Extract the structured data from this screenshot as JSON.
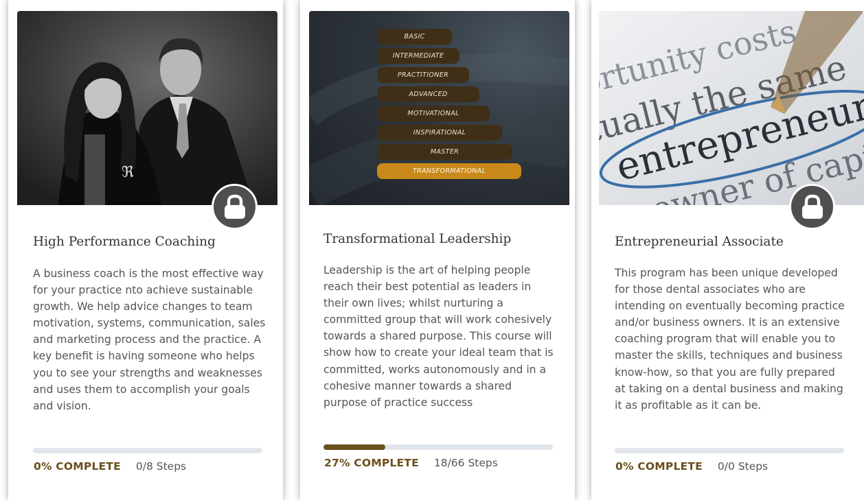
{
  "colors": {
    "accent": "#6b4f1c",
    "lock": "#4f4f4f",
    "track": "#e1e6ec",
    "ladder_rung": "#3f2f17",
    "ladder_highlight": "#c98a1b"
  },
  "courses": [
    {
      "title": "High Performance Coaching",
      "description": "A business coach is the most effective way for your practice nto achieve sustainable growth. We help advice changes to team motivation, systems, communication, sales and marketing process and the practice. A key benefit is having someone who helps you to see your strengths and weaknesses and uses them to accomplish your goals and vision.",
      "progress": 0,
      "progress_label": "0% COMPLETE",
      "steps_label": "0/8 Steps",
      "locked": true,
      "image": "coaches-photo",
      "icon": "lock-icon"
    },
    {
      "title": "Transformational Leadership",
      "description": "Leadership is the art of helping people reach their best potential as leaders in their own lives; whilst nurturing a committed group that will work cohesively towards a shared purpose. This course will show how to create your ideal team that is committed, works autonomously and in a cohesive manner towards a shared purpose of practice success",
      "progress": 27,
      "progress_label": "27% COMPLETE",
      "steps_label": "18/66 Steps",
      "locked": false,
      "image": "leadership-ladder",
      "ladder": [
        "BASIC",
        "INTERMEDIATE",
        "PRACTITIONER",
        "ADVANCED",
        "MOTIVATIONAL",
        "INSPIRATIONAL",
        "MASTER",
        "TRANSFORMATIONAL"
      ]
    },
    {
      "title": "Entrepreneurial Associate",
      "description": "This program has been unique developed for those dental associates who are intending on eventually becoming practice and/or business owners. It is an extensive coaching program that will enable you to master the skills, techniques and business know-how, so that you are fully prepared at taking on a dental business and making it as profitable as it can be.",
      "progress": 0,
      "progress_label": "0% COMPLETE",
      "steps_label": "0/0 Steps",
      "locked": true,
      "image": "entrepreneurs-text-photo",
      "icon": "lock-icon",
      "photo_text": [
        "ortunity costs",
        "tually the same",
        "entrepreneurs.",
        "an owner of capital"
      ]
    }
  ]
}
